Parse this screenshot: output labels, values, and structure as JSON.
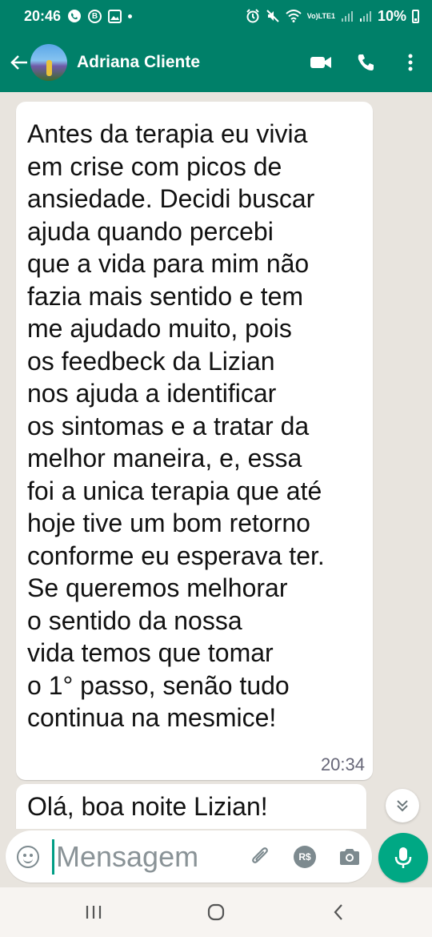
{
  "status_bar": {
    "time": "20:46",
    "battery_percent": "10%",
    "network_label_top": "Vo)",
    "network_label_bottom": "LTE1",
    "b_badge": "B"
  },
  "header": {
    "contact_name": "Adriana Cliente"
  },
  "messages": [
    {
      "text": "Antes da terapia eu vivia\nem crise com picos de\nansiedade. Decidi buscar\najuda quando percebi\nque a vida para mim não\nfazia mais sentido e tem\nme ajudado muito, pois\nos feedbeck da Lizian\nnos ajuda a identificar\nos sintomas e a tratar da\nmelhor maneira, e, essa\nfoi a unica terapia que até\nhoje tive um bom retorno\nconforme eu esperava ter.\nSe queremos melhorar\no sentido da nossa\nvida temos que tomar\no 1° passo, senão tudo\ncontinua na mesmice!",
      "time": "20:34"
    },
    {
      "text": "Olá, boa noite Lizian!"
    }
  ],
  "composer": {
    "placeholder": "Mensagem",
    "rs_label": "R$"
  },
  "colors": {
    "header_green": "#008069",
    "accent_green": "#00a884",
    "chat_background": "#e8e4de"
  }
}
